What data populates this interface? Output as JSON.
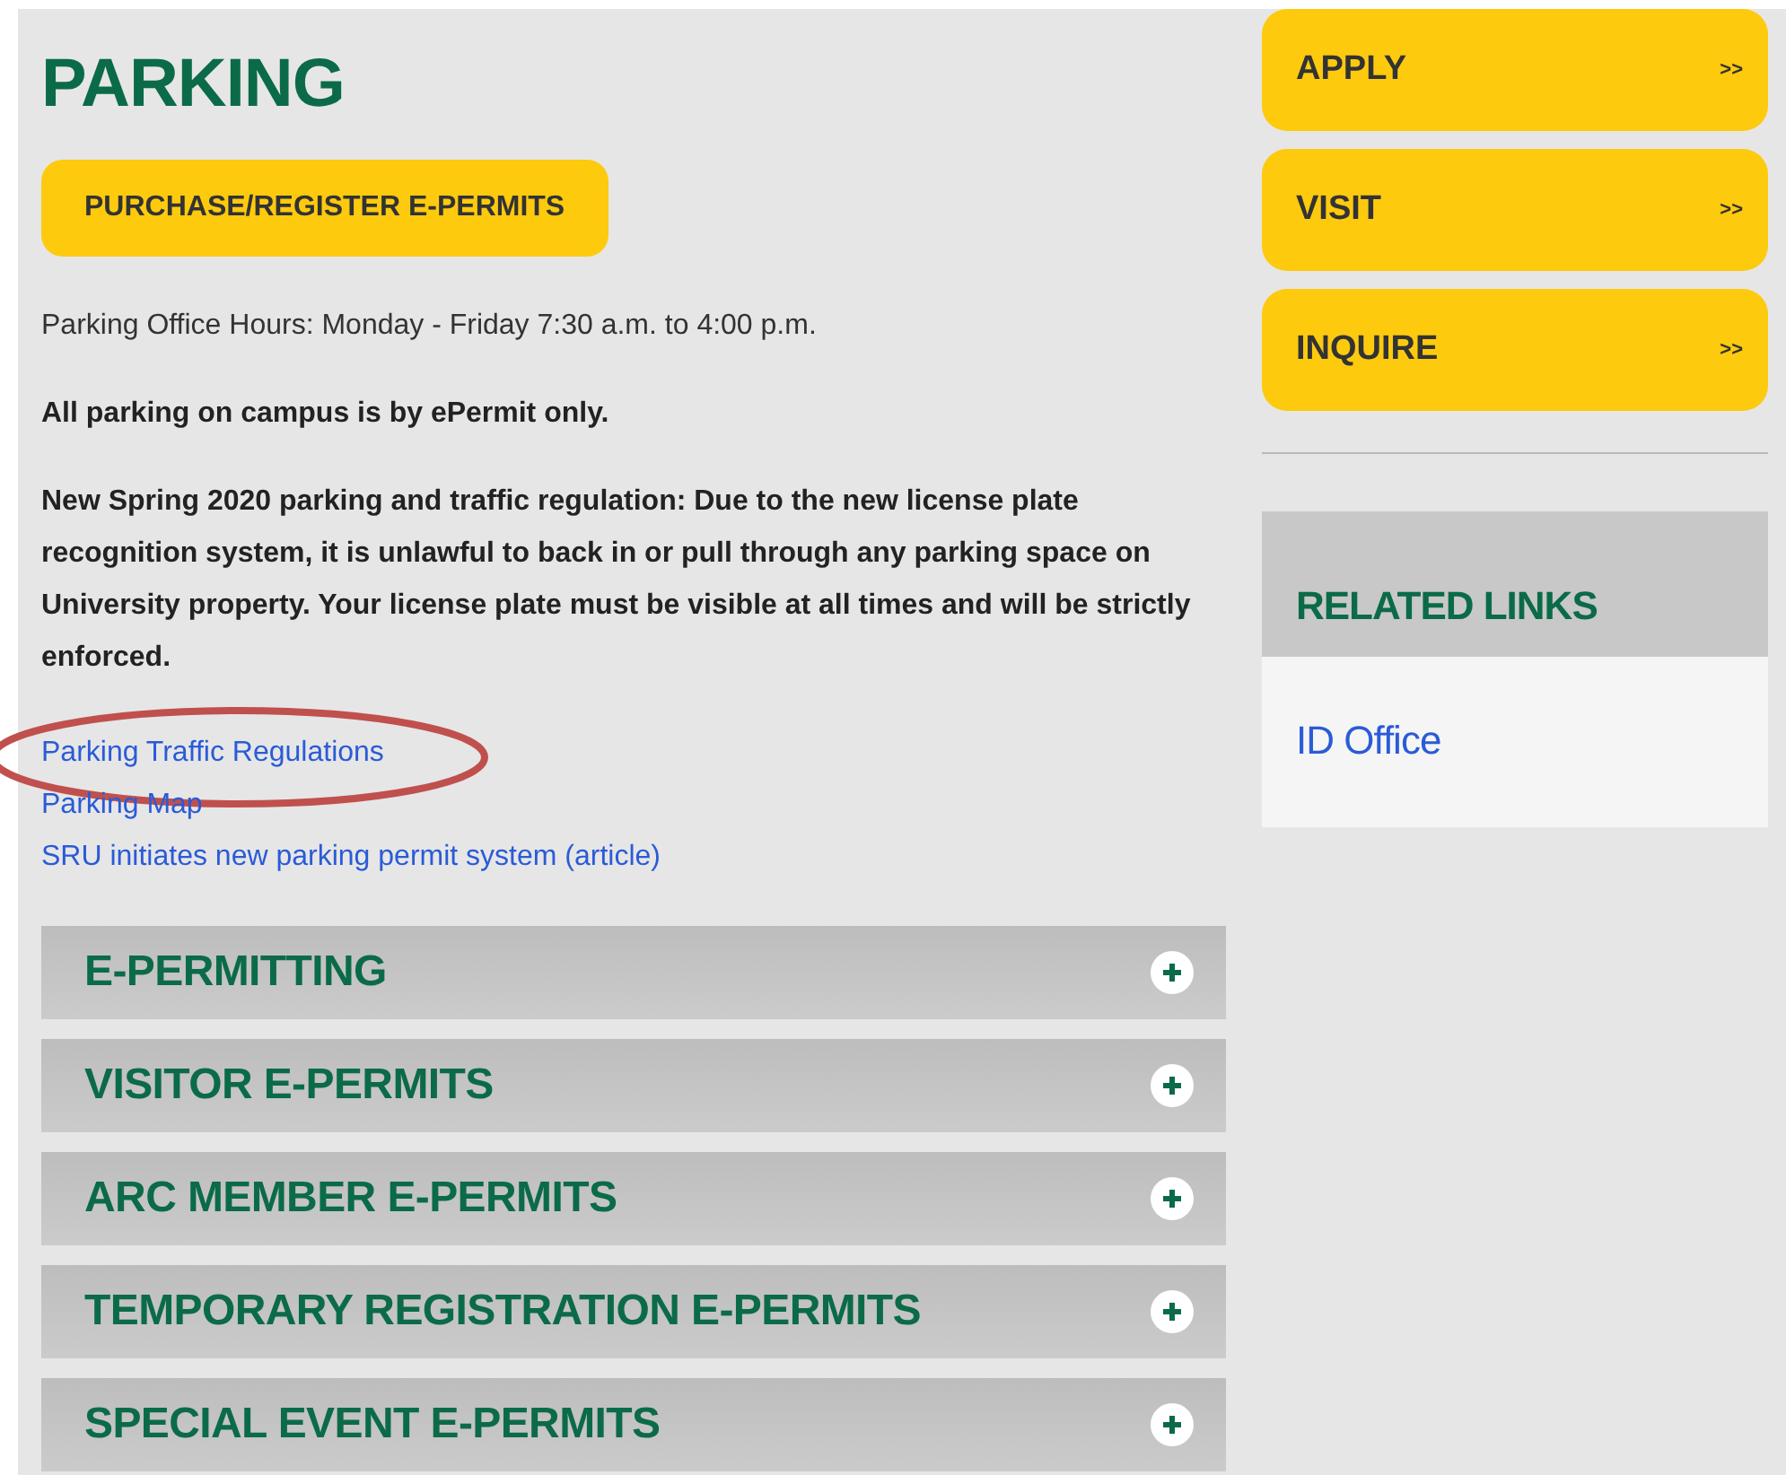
{
  "title": "PARKING",
  "purchase_button": "PURCHASE/REGISTER E-PERMITS",
  "paragraphs": [
    {
      "text": "Parking Office Hours: Monday - Friday 7:30 a.m. to 4:00 p.m.",
      "bold": false
    },
    {
      "text": "All parking on campus is by ePermit only.",
      "bold": true
    },
    {
      "text": "New Spring 2020 parking and traffic regulation: Due to the new license plate recognition system, it is unlawful to back in or pull through any parking space on University property. Your license plate must be visible at all times and will be strictly enforced.",
      "bold": true
    }
  ],
  "links": [
    {
      "label": "Parking Traffic Regulations",
      "circled": true
    },
    {
      "label": "Parking Map",
      "circled": false
    },
    {
      "label": "SRU initiates new parking permit system (article)",
      "circled": false
    }
  ],
  "accordion": [
    {
      "label": "E-PERMITTING",
      "expanded": false
    },
    {
      "label": "VISITOR E-PERMITS",
      "expanded": false
    },
    {
      "label": "ARC MEMBER E-PERMITS",
      "expanded": false
    },
    {
      "label": "TEMPORARY REGISTRATION E-PERMITS",
      "expanded": false
    },
    {
      "label": "SPECIAL EVENT E-PERMITS",
      "expanded": false
    }
  ],
  "sidebar": {
    "actions": [
      {
        "label": "APPLY",
        "arrow": ">>"
      },
      {
        "label": "VISIT",
        "arrow": ">>"
      },
      {
        "label": "INQUIRE",
        "arrow": ">>"
      }
    ],
    "related_links": {
      "heading": "RELATED LINKS",
      "links": [
        "ID Office"
      ]
    }
  }
}
